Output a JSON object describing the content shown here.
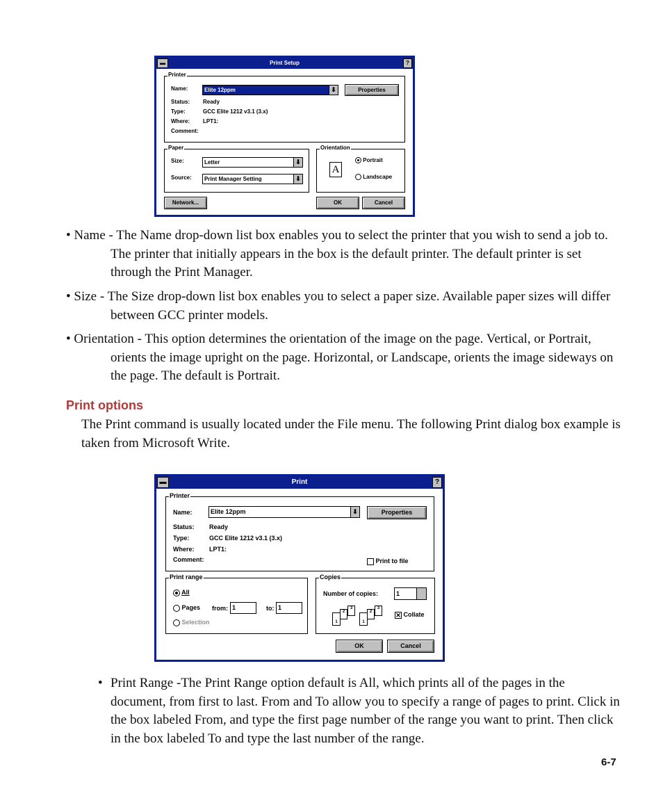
{
  "print_setup": {
    "title": "Print Setup",
    "help": "?",
    "printer_group": "Printer",
    "name_label": "Name:",
    "name_value": "Elite 12ppm",
    "properties": "Properties",
    "status_label": "Status:",
    "status_value": "Ready",
    "type_label": "Type:",
    "type_value": "GCC Elite 1212 v3.1 (3.x)",
    "where_label": "Where:",
    "where_value": "LPT1:",
    "comment_label": "Comment:",
    "paper_group": "Paper",
    "size_label": "Size:",
    "size_value": "Letter",
    "source_label": "Source:",
    "source_value": "Print Manager Setting",
    "orientation_group": "Orientation",
    "orientation_icon_letter": "A",
    "portrait": "Portrait",
    "landscape": "Landscape",
    "orientation_selected": "Portrait",
    "network": "Network...",
    "ok": "OK",
    "cancel": "Cancel",
    "title_bar_color": "#0b1f8f"
  },
  "bullets1": [
    "• Name - The Name drop-down list box enables you to select the printer that you wish to send a job to. The printer that initially appears in the box is the default printer. The default printer is set through the Print Manager.",
    "• Size - The Size drop-down list box enables you to select a paper size. Available paper sizes will differ between GCC printer models.",
    "• Orientation - This option determines the orientation of the image on the page. Vertical, or Portrait, orients the image upright on the page. Horizontal, or Landscape, orients the image sideways on the page. The default is Portrait."
  ],
  "heading": "Print options",
  "heading_color": "#b03a3a",
  "intro": "The Print command is usually located under the File menu. The following Print dialog box example is taken from Microsoft Write.",
  "print": {
    "title": "Print",
    "help": "?",
    "printer_group": "Printer",
    "name_label": "Name:",
    "name_value": "Elite 12ppm",
    "properties": "Properties",
    "status_label": "Status:",
    "status_value": "Ready",
    "type_label": "Type:",
    "type_value": "GCC Elite 1212 v3.1 (3.x)",
    "where_label": "Where:",
    "where_value": "LPT1:",
    "comment_label": "Comment:",
    "print_to_file": "Print to file",
    "print_to_file_checked": false,
    "range_group": "Print range",
    "all": "All",
    "pages": "Pages",
    "from_label": "from:",
    "from_value": "1",
    "to_label": "to:",
    "to_value": "1",
    "selection": "Selection",
    "range_selected": "All",
    "copies_group": "Copies",
    "copies_label": "Number of copies:",
    "copies_value": "1",
    "sheets": [
      "1",
      "2",
      "3"
    ],
    "collate": "Collate",
    "collate_checked": true,
    "ok": "OK",
    "cancel": "Cancel"
  },
  "bullet2_marker": "•",
  "bullet2": "Print Range -The Print Range option default is All, which prints all of the pages in the document, from first to last. From and To allow you to specify a range of pages to print. Click in the box labeled From, and type the first page number of the range you want to print. Then click in the box labeled To and type the last number of the range.",
  "page_number": "6-7"
}
